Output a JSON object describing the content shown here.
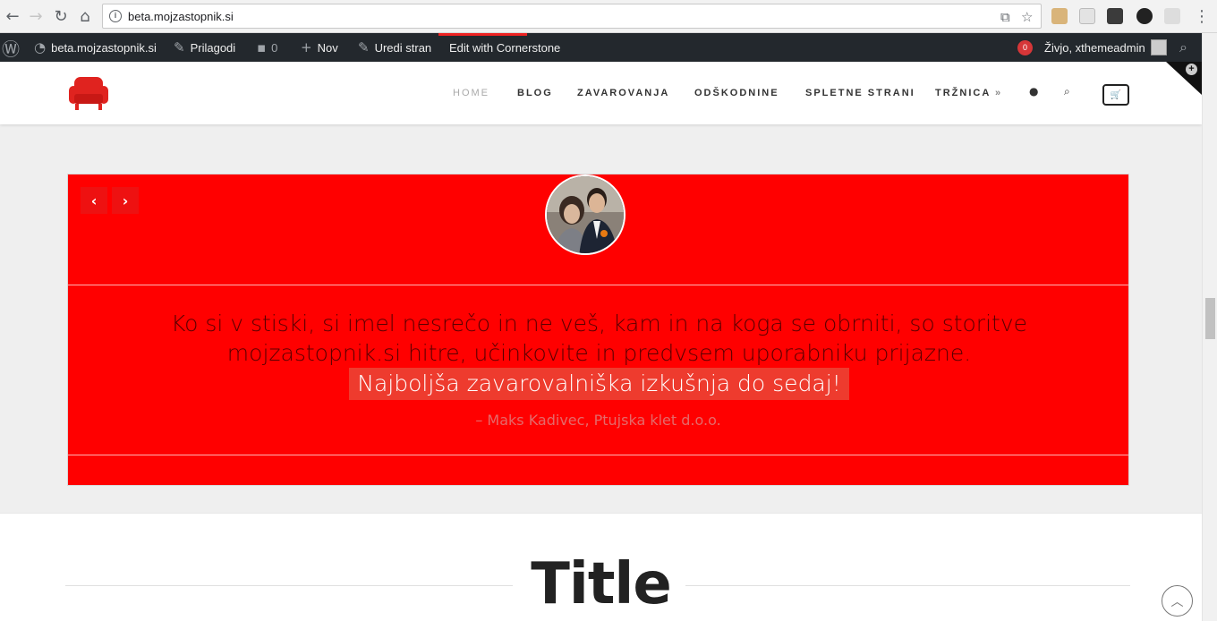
{
  "browser": {
    "url": "beta.mojzastopnik.si",
    "back_icon": "arrow-left-icon",
    "forward_icon": "arrow-right-icon",
    "reload_icon": "reload-icon",
    "home_icon": "home-icon"
  },
  "admin_bar": {
    "site_name": "beta.mojzastopnik.si",
    "customize": "Prilagodi",
    "comments_count": "0",
    "new_label": "Nov",
    "edit_page": "Uredi stran",
    "cornerstone": "Edit with Cornerstone",
    "notifications": "0",
    "greeting": "Živjo, xthemeadmin"
  },
  "site_menu": {
    "items": [
      "HOME",
      "BLOG",
      "ZAVAROVANJA",
      "ODŠKODNINE",
      "SPLETNE STRANI",
      "TRŽNICA"
    ],
    "dropdown_indicator": "»"
  },
  "testimonial": {
    "quote": "Ko si v stiski, si imel nesrečo in ne veš, kam in na koga se obrniti, so storitve mojzastopnik.si hitre, učinkovite in predvsem uporabniku prijazne.",
    "highlight": "Najboljša zavarovalniška izkušnja do sedaj!",
    "cite": "– Maks Kadivec, Ptujska klet d.o.o.",
    "prev_label": "‹",
    "next_label": "›"
  },
  "content": {
    "title": "Title"
  },
  "colors": {
    "brand_red": "#ff0000",
    "admin_bar": "#23282d",
    "accent": "#d63638"
  }
}
